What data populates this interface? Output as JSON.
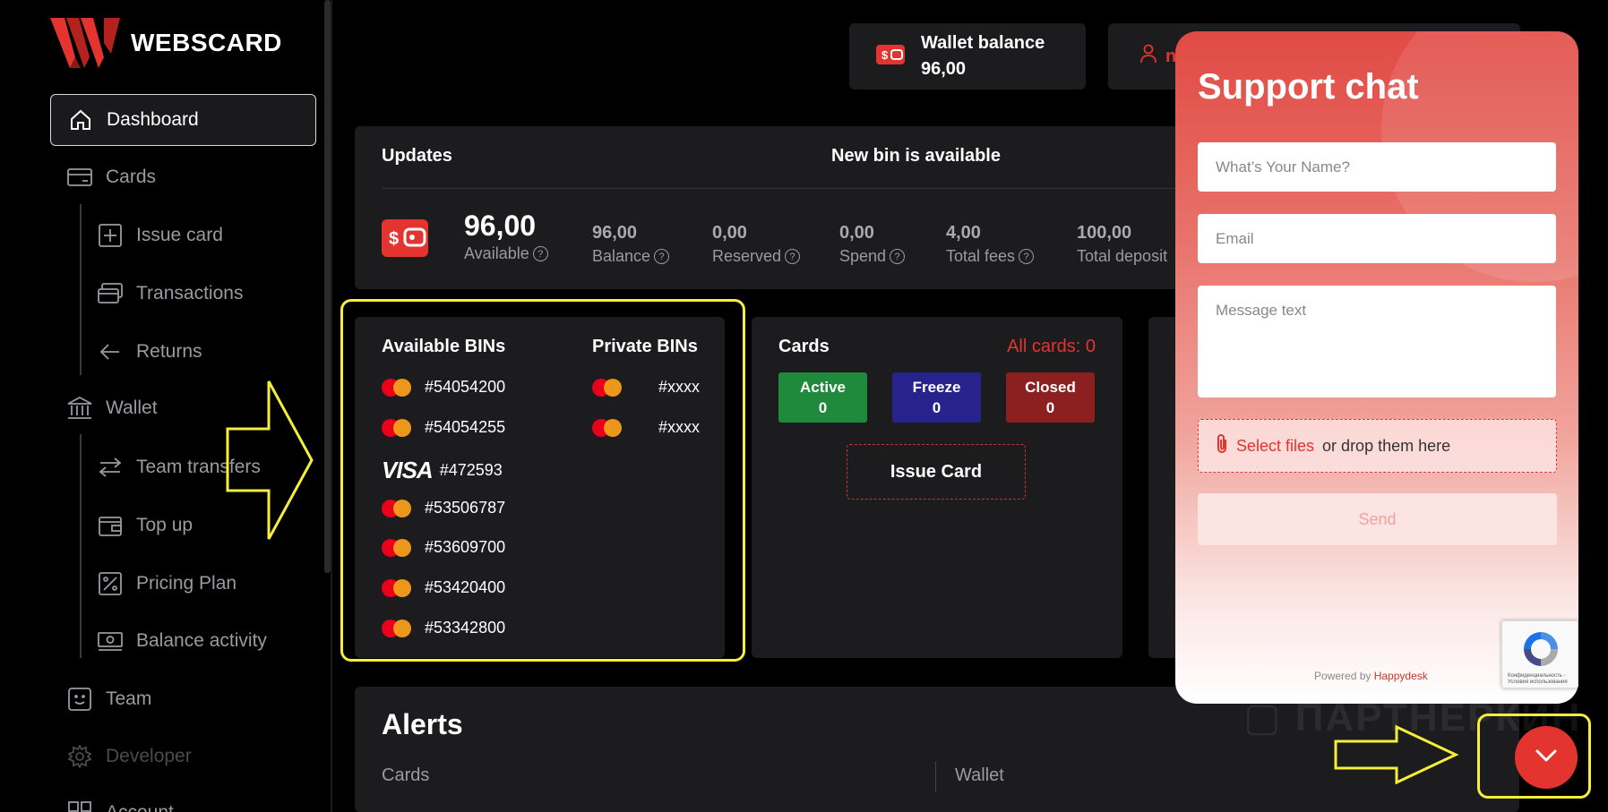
{
  "app": {
    "logo_text": "WEBSCARD",
    "accent": "#e3342f"
  },
  "sidebar": {
    "items": [
      {
        "label": "Dashboard",
        "icon": "home-icon"
      },
      {
        "label": "Cards",
        "icon": "card-icon"
      },
      {
        "label": "Issue card",
        "icon": "plus-square-icon"
      },
      {
        "label": "Transactions",
        "icon": "transactions-icon"
      },
      {
        "label": "Returns",
        "icon": "arrow-left-icon"
      },
      {
        "label": "Wallet",
        "icon": "bank-icon"
      },
      {
        "label": "Team transfers",
        "icon": "swap-icon"
      },
      {
        "label": "Top up",
        "icon": "wallet-icon"
      },
      {
        "label": "Pricing Plan",
        "icon": "percent-icon"
      },
      {
        "label": "Balance activity",
        "icon": "cash-icon"
      },
      {
        "label": "Team",
        "icon": "smile-icon"
      },
      {
        "label": "Developer",
        "icon": "gear-icon"
      },
      {
        "label": "Account",
        "icon": "grid-icon"
      }
    ]
  },
  "header": {
    "wallet_label": "Wallet balance",
    "wallet_value": "96,00",
    "user_initial": "n"
  },
  "updates": {
    "title": "Updates",
    "news": "New bin is available",
    "available_value": "96,00",
    "available_label": "Available",
    "stats": [
      {
        "value": "96,00",
        "label": "Balance"
      },
      {
        "value": "0,00",
        "label": "Reserved"
      },
      {
        "value": "0,00",
        "label": "Spend"
      },
      {
        "value": "4,00",
        "label": "Total fees"
      },
      {
        "value": "100,00",
        "label": "Total deposit"
      }
    ]
  },
  "bins": {
    "available_title": "Available BINs",
    "private_title": "Private BINs",
    "available": [
      {
        "brand": "mastercard",
        "code": "#54054200"
      },
      {
        "brand": "mastercard",
        "code": "#54054255"
      },
      {
        "brand": "visa",
        "label": "VISA",
        "code": "#472593"
      },
      {
        "brand": "mastercard",
        "code": "#53506787"
      },
      {
        "brand": "mastercard",
        "code": "#53609700"
      },
      {
        "brand": "mastercard",
        "code": "#53420400"
      },
      {
        "brand": "mastercard",
        "code": "#53342800"
      }
    ],
    "private": [
      {
        "brand": "mastercard",
        "code": "#xxxx"
      },
      {
        "brand": "mastercard",
        "code": "#xxxx"
      }
    ]
  },
  "cards": {
    "title": "Cards",
    "all_label": "All cards: 0",
    "statuses": [
      {
        "label": "Active",
        "count": "0",
        "color": "#1f8a3b"
      },
      {
        "label": "Freeze",
        "count": "0",
        "color": "#26248c"
      },
      {
        "label": "Closed",
        "count": "0",
        "color": "#8c1f1f"
      }
    ],
    "issue_button": "Issue Card"
  },
  "alerts": {
    "title": "Alerts",
    "col1": "Cards",
    "col2": "Wallet"
  },
  "chat": {
    "title": "Support chat",
    "name_placeholder": "What’s Your Name?",
    "email_placeholder": "Email",
    "message_placeholder": "Message text",
    "select_files": "Select files",
    "drop_text": "or drop them here",
    "send": "Send",
    "powered_by": "Powered by",
    "brand": "Happydesk",
    "recaptcha_text": "Конфиденциальность - Условия использования"
  }
}
